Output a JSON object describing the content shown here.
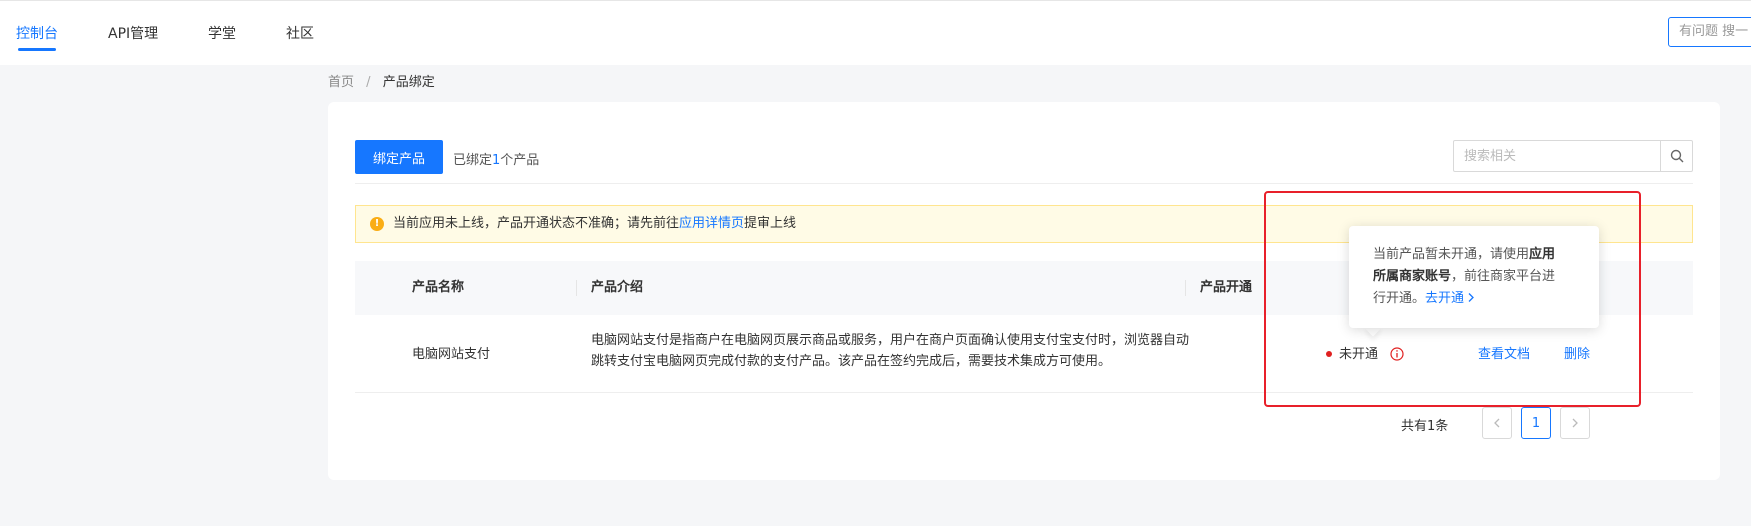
{
  "nav": {
    "items": [
      "控制台",
      "API管理",
      "学堂",
      "社区"
    ],
    "active_index": 0,
    "help_search_placeholder": "有问题 搜一"
  },
  "breadcrumb": {
    "home": "首页",
    "separator": "/",
    "current": "产品绑定"
  },
  "toolbar": {
    "bind_button": "绑定产品",
    "bound_prefix": "已绑定",
    "bound_count": "1",
    "bound_suffix": "个产品",
    "search_placeholder": "搜索相关"
  },
  "alert": {
    "text_before": "当前应用未上线，产品开通状态不准确；请先前往",
    "link": "应用详情页",
    "text_after": "提审上线",
    "icon": "warning-icon"
  },
  "table": {
    "columns": [
      "产品名称",
      "产品介绍",
      "产品开通"
    ],
    "rows": [
      {
        "name": "电脑网站支付",
        "description_line1": "电脑网站支付是指商户在电脑网页展示商品或服务，用户在商户页面确认使用支付宝支付时，浏览器自动",
        "description_line2": "跳转支付宝电脑网页完成付款的支付产品。该产品在签约完成后，需要技术集成方可使用。",
        "status": "未开通",
        "status_color": "#e02020",
        "actions": [
          "查看文档",
          "删除"
        ]
      }
    ]
  },
  "pagination": {
    "total": "共有1条",
    "current_page": "1"
  },
  "tooltip": {
    "part1": "当前产品暂未开通，请使用",
    "bold1": "应用",
    "bold2": "所属商家账号",
    "part2": "，前往商家平台进",
    "part3": "行开通。",
    "link": "去开通",
    "link_chevron": "chevron-right-icon"
  },
  "colors": {
    "accent": "#1677ff",
    "highlight": "#e8202a",
    "alert_bg": "#fffbe6"
  }
}
